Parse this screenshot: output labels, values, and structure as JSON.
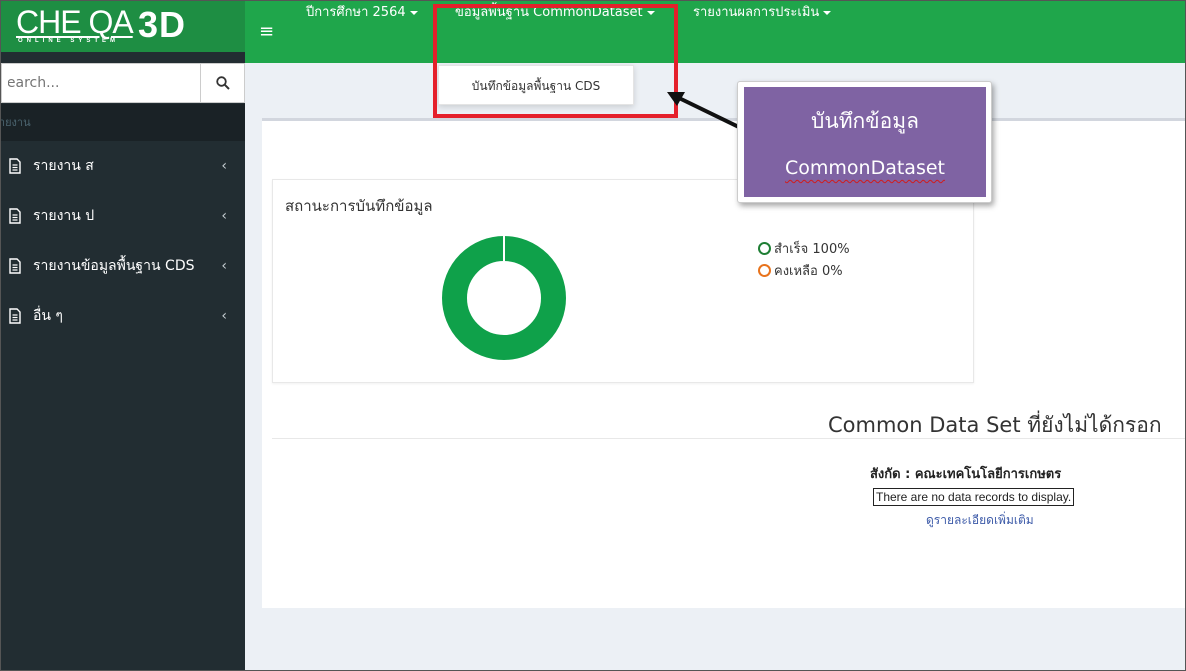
{
  "app": {
    "logo_text": "CHE QA",
    "logo_3d": "3D",
    "logo_subtitle": "ONLINE SYSTEM"
  },
  "sidebar": {
    "search_placeholder": "Search...",
    "header": "รายงาน",
    "items": [
      {
        "label": "รายงาน ส"
      },
      {
        "label": "รายงาน ป"
      },
      {
        "label": "รายงานข้อมูลพื้นฐาน CDS"
      },
      {
        "label": "อื่น ๆ"
      }
    ]
  },
  "topnav": {
    "year": "ปีการศึกษา 2564",
    "common_dataset": "ข้อมูลพื้นฐาน CommonDataset",
    "report": "รายงานผลการประเมิน"
  },
  "dropdown": {
    "item": "บันทึกข้อมูลพื้นฐาน CDS"
  },
  "callout": {
    "line1": "บันทึกข้อมูล",
    "line2": "CommonDataset"
  },
  "status": {
    "title": "สถานะการบันทึกข้อมูล",
    "legend": [
      {
        "label": "สำเร็จ 100%",
        "color": "#1e7e34"
      },
      {
        "label": "คงเหลือ 0%",
        "color": "#e8731c"
      }
    ]
  },
  "chart_data": {
    "type": "pie",
    "categories": [
      "สำเร็จ",
      "คงเหลือ"
    ],
    "values": [
      100,
      0
    ],
    "colors": [
      "#0fa14a",
      "#e8731c"
    ]
  },
  "cds": {
    "title": "Common Data Set ที่ยังไม่ได้กรอก",
    "affiliation": "สังกัด : คณะเทคโนโลยีการเกษตร",
    "no_records": "There are no data records to display.",
    "more_link": "ดูรายละเอียดเพิ่มเติม"
  },
  "colors": {
    "navbar": "#1fa64b",
    "sidebar": "#222d32",
    "highlight": "#e5202b",
    "callout": "#7f63a3"
  }
}
